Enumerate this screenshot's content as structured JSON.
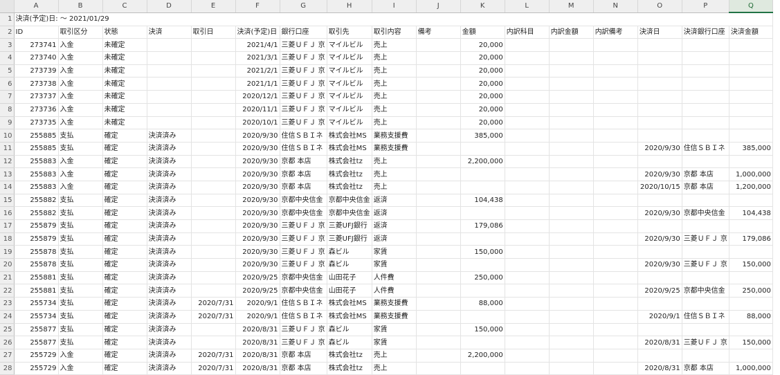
{
  "columns": [
    "A",
    "B",
    "C",
    "D",
    "E",
    "F",
    "G",
    "H",
    "I",
    "J",
    "K",
    "L",
    "M",
    "N",
    "O",
    "P",
    "Q"
  ],
  "active_column": "Q",
  "row1": {
    "title": "決済(予定)日: ～ 2021/01/29"
  },
  "headers": [
    "ID",
    "取引区分",
    "状態",
    "決済",
    "取引日",
    "決済(予定)日",
    "銀行口座",
    "取引先",
    "取引内容",
    "備考",
    "金額",
    "内訳科目",
    "内訳金額",
    "内訳備考",
    "決済日",
    "決済銀行口座",
    "決済金額"
  ],
  "rows": [
    [
      "273741",
      "入金",
      "未確定",
      "",
      "",
      "2021/4/1",
      "三菱ＵＦＪ 京",
      "マイルビル",
      "売上",
      "",
      "20,000",
      "",
      "",
      "",
      "",
      "",
      ""
    ],
    [
      "273740",
      "入金",
      "未確定",
      "",
      "",
      "2021/3/1",
      "三菱ＵＦＪ 京",
      "マイルビル",
      "売上",
      "",
      "20,000",
      "",
      "",
      "",
      "",
      "",
      ""
    ],
    [
      "273739",
      "入金",
      "未確定",
      "",
      "",
      "2021/2/1",
      "三菱ＵＦＪ 京",
      "マイルビル",
      "売上",
      "",
      "20,000",
      "",
      "",
      "",
      "",
      "",
      ""
    ],
    [
      "273738",
      "入金",
      "未確定",
      "",
      "",
      "2021/1/1",
      "三菱ＵＦＪ 京",
      "マイルビル",
      "売上",
      "",
      "20,000",
      "",
      "",
      "",
      "",
      "",
      ""
    ],
    [
      "273737",
      "入金",
      "未確定",
      "",
      "",
      "2020/12/1",
      "三菱ＵＦＪ 京",
      "マイルビル",
      "売上",
      "",
      "20,000",
      "",
      "",
      "",
      "",
      "",
      ""
    ],
    [
      "273736",
      "入金",
      "未確定",
      "",
      "",
      "2020/11/1",
      "三菱ＵＦＪ 京",
      "マイルビル",
      "売上",
      "",
      "20,000",
      "",
      "",
      "",
      "",
      "",
      ""
    ],
    [
      "273735",
      "入金",
      "未確定",
      "",
      "",
      "2020/10/1",
      "三菱ＵＦＪ 京",
      "マイルビル",
      "売上",
      "",
      "20,000",
      "",
      "",
      "",
      "",
      "",
      ""
    ],
    [
      "255885",
      "支払",
      "確定",
      "決済済み",
      "",
      "2020/9/30",
      "住信ＳＢＩネ",
      "株式会社MS",
      "業務支援費",
      "",
      "385,000",
      "",
      "",
      "",
      "",
      "",
      ""
    ],
    [
      "255885",
      "支払",
      "確定",
      "決済済み",
      "",
      "2020/9/30",
      "住信ＳＢＩネ",
      "株式会社MS",
      "業務支援費",
      "",
      "",
      "",
      "",
      "",
      "2020/9/30",
      "住信ＳＢＩネ",
      "385,000"
    ],
    [
      "255883",
      "入金",
      "確定",
      "決済済み",
      "",
      "2020/9/30",
      "京都 本店",
      "株式会社tz",
      "売上",
      "",
      "2,200,000",
      "",
      "",
      "",
      "",
      "",
      ""
    ],
    [
      "255883",
      "入金",
      "確定",
      "決済済み",
      "",
      "2020/9/30",
      "京都 本店",
      "株式会社tz",
      "売上",
      "",
      "",
      "",
      "",
      "",
      "2020/9/30",
      "京都 本店",
      "1,000,000"
    ],
    [
      "255883",
      "入金",
      "確定",
      "決済済み",
      "",
      "2020/9/30",
      "京都 本店",
      "株式会社tz",
      "売上",
      "",
      "",
      "",
      "",
      "",
      "2020/10/15",
      "京都 本店",
      "1,200,000"
    ],
    [
      "255882",
      "支払",
      "確定",
      "決済済み",
      "",
      "2020/9/30",
      "京都中央信金",
      "京都中央信金",
      "返済",
      "",
      "104,438",
      "",
      "",
      "",
      "",
      "",
      ""
    ],
    [
      "255882",
      "支払",
      "確定",
      "決済済み",
      "",
      "2020/9/30",
      "京都中央信金",
      "京都中央信金",
      "返済",
      "",
      "",
      "",
      "",
      "",
      "2020/9/30",
      "京都中央信金",
      "104,438"
    ],
    [
      "255879",
      "支払",
      "確定",
      "決済済み",
      "",
      "2020/9/30",
      "三菱ＵＦＪ 京",
      "三菱UFJ銀行",
      "返済",
      "",
      "179,086",
      "",
      "",
      "",
      "",
      "",
      ""
    ],
    [
      "255879",
      "支払",
      "確定",
      "決済済み",
      "",
      "2020/9/30",
      "三菱ＵＦＪ 京",
      "三菱UFJ銀行",
      "返済",
      "",
      "",
      "",
      "",
      "",
      "2020/9/30",
      "三菱ＵＦＪ 京",
      "179,086"
    ],
    [
      "255878",
      "支払",
      "確定",
      "決済済み",
      "",
      "2020/9/30",
      "三菱ＵＦＪ 京",
      "森ビル",
      "家賃",
      "",
      "150,000",
      "",
      "",
      "",
      "",
      "",
      ""
    ],
    [
      "255878",
      "支払",
      "確定",
      "決済済み",
      "",
      "2020/9/30",
      "三菱ＵＦＪ 京",
      "森ビル",
      "家賃",
      "",
      "",
      "",
      "",
      "",
      "2020/9/30",
      "三菱ＵＦＪ 京",
      "150,000"
    ],
    [
      "255881",
      "支払",
      "確定",
      "決済済み",
      "",
      "2020/9/25",
      "京都中央信金",
      "山田花子",
      "人件費",
      "",
      "250,000",
      "",
      "",
      "",
      "",
      "",
      ""
    ],
    [
      "255881",
      "支払",
      "確定",
      "決済済み",
      "",
      "2020/9/25",
      "京都中央信金",
      "山田花子",
      "人件費",
      "",
      "",
      "",
      "",
      "",
      "2020/9/25",
      "京都中央信金",
      "250,000"
    ],
    [
      "255734",
      "支払",
      "確定",
      "決済済み",
      "2020/7/31",
      "2020/9/1",
      "住信ＳＢＩネ",
      "株式会社MS",
      "業務支援費",
      "",
      "88,000",
      "",
      "",
      "",
      "",
      "",
      ""
    ],
    [
      "255734",
      "支払",
      "確定",
      "決済済み",
      "2020/7/31",
      "2020/9/1",
      "住信ＳＢＩネ",
      "株式会社MS",
      "業務支援費",
      "",
      "",
      "",
      "",
      "",
      "2020/9/1",
      "住信ＳＢＩネ",
      "88,000"
    ],
    [
      "255877",
      "支払",
      "確定",
      "決済済み",
      "",
      "2020/8/31",
      "三菱ＵＦＪ 京",
      "森ビル",
      "家賃",
      "",
      "150,000",
      "",
      "",
      "",
      "",
      "",
      ""
    ],
    [
      "255877",
      "支払",
      "確定",
      "決済済み",
      "",
      "2020/8/31",
      "三菱ＵＦＪ 京",
      "森ビル",
      "家賃",
      "",
      "",
      "",
      "",
      "",
      "2020/8/31",
      "三菱ＵＦＪ 京",
      "150,000"
    ],
    [
      "255729",
      "入金",
      "確定",
      "決済済み",
      "2020/7/31",
      "2020/8/31",
      "京都 本店",
      "株式会社tz",
      "売上",
      "",
      "2,200,000",
      "",
      "",
      "",
      "",
      "",
      ""
    ],
    [
      "255729",
      "入金",
      "確定",
      "決済済み",
      "2020/7/31",
      "2020/8/31",
      "京都 本店",
      "株式会社tz",
      "売上",
      "",
      "",
      "",
      "",
      "",
      "2020/8/31",
      "京都 本店",
      "1,000,000"
    ]
  ]
}
